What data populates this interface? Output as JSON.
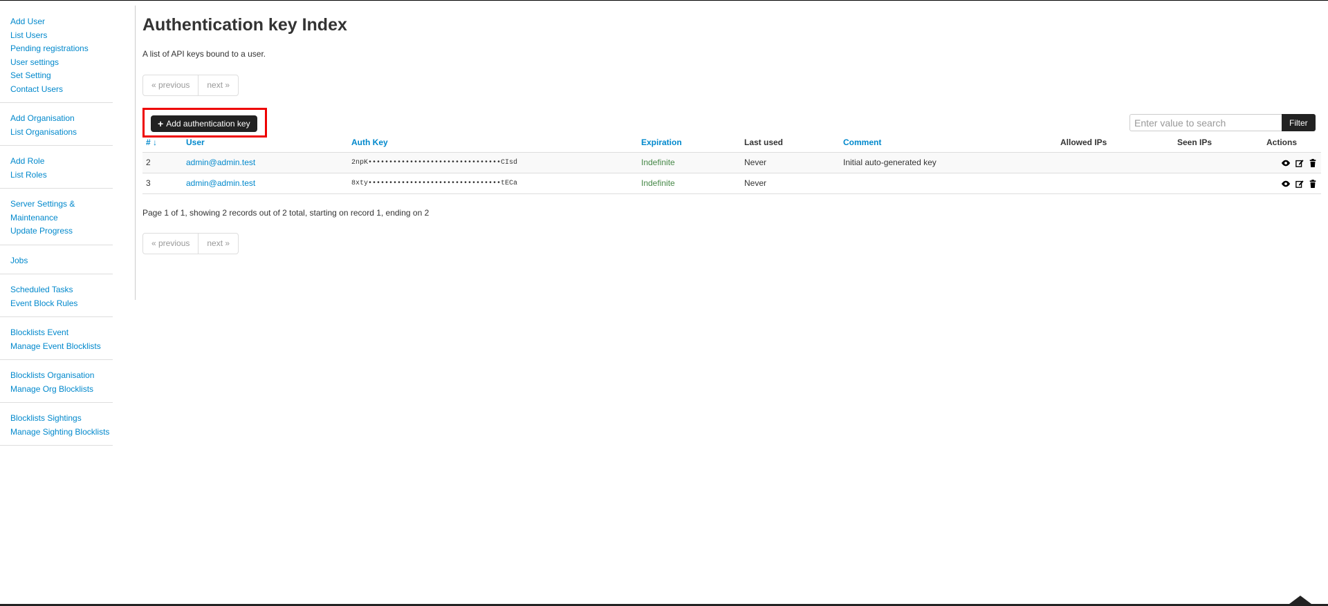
{
  "sidebar": {
    "groups": [
      [
        "Add User",
        "List Users",
        "Pending registrations",
        "User settings",
        "Set Setting",
        "Contact Users"
      ],
      [
        "Add Organisation",
        "List Organisations"
      ],
      [
        "Add Role",
        "List Roles"
      ],
      [
        "Server Settings & Maintenance",
        "Update Progress"
      ],
      [
        "Jobs"
      ],
      [
        "Scheduled Tasks",
        "Event Block Rules"
      ],
      [
        "Blocklists Event",
        "Manage Event Blocklists"
      ],
      [
        "Blocklists Organisation",
        "Manage Org Blocklists"
      ],
      [
        "Blocklists Sightings",
        "Manage Sighting Blocklists"
      ]
    ]
  },
  "page": {
    "title": "Authentication key Index",
    "description": "A list of API keys bound to a user."
  },
  "pager": {
    "previous": "« previous",
    "next": "next »"
  },
  "toolbar": {
    "add_label": "Add authentication key",
    "add_icon": "plus-icon"
  },
  "search": {
    "placeholder": "Enter value to search",
    "filter_label": "Filter"
  },
  "table": {
    "headers": {
      "id": "#",
      "id_sort_icon": "↓",
      "user": "User",
      "auth_key": "Auth Key",
      "expiration": "Expiration",
      "last_used": "Last used",
      "comment": "Comment",
      "allowed_ips": "Allowed IPs",
      "seen_ips": "Seen IPs",
      "actions": "Actions"
    },
    "rows": [
      {
        "id": "2",
        "user": "admin@admin.test",
        "auth_key": "2npK••••••••••••••••••••••••••••••••CIsd",
        "expiration": "Indefinite",
        "last_used": "Never",
        "comment": "Initial auto-generated key",
        "allowed_ips": "",
        "seen_ips": ""
      },
      {
        "id": "3",
        "user": "admin@admin.test",
        "auth_key": "8xty••••••••••••••••••••••••••••••••tECa",
        "expiration": "Indefinite",
        "last_used": "Never",
        "comment": "",
        "allowed_ips": "",
        "seen_ips": ""
      }
    ],
    "action_icons": [
      "eye-icon",
      "edit-icon",
      "trash-icon"
    ]
  },
  "page_info": "Page 1 of 1, showing 2 records out of 2 total, starting on record 1, ending on 2",
  "colors": {
    "link": "#0088cc",
    "green": "#468847",
    "highlight": "#ee0000",
    "button": "#222222"
  }
}
